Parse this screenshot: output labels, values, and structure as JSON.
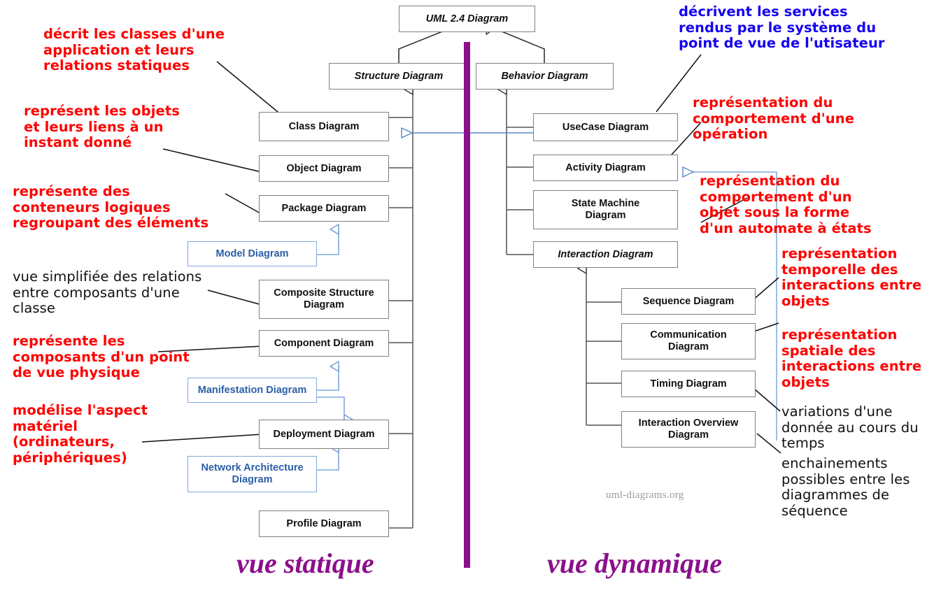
{
  "meta": {
    "watermark": "uml-diagrams.org",
    "divider_color": "#8B0F8B",
    "red": "#FF0000",
    "blue_text": "#1400F0",
    "blue_box": "#2B5EA8",
    "box_border": "#808080"
  },
  "view_labels": {
    "left": "vue statique",
    "right": "vue dynamique"
  },
  "root": {
    "label": "UML 2.4 Diagram"
  },
  "branches": {
    "structure": {
      "label": "Structure Diagram"
    },
    "behavior": {
      "label": "Behavior Diagram"
    }
  },
  "structure_children": [
    {
      "label": "Class Diagram"
    },
    {
      "label": "Object Diagram"
    },
    {
      "label": "Package Diagram"
    },
    {
      "label": "Composite Structure\nDiagram"
    },
    {
      "label": "Component Diagram"
    },
    {
      "label": "Deployment Diagram"
    },
    {
      "label": "Profile Diagram"
    }
  ],
  "structure_blue_children": [
    {
      "label": "Model Diagram"
    },
    {
      "label": "Manifestation Diagram"
    },
    {
      "label": "Network Architecture\nDiagram"
    }
  ],
  "behavior_children": [
    {
      "label": "UseCase Diagram"
    },
    {
      "label": "Activity Diagram"
    },
    {
      "label": "State Machine\nDiagram"
    },
    {
      "label": "Interaction Diagram"
    }
  ],
  "interaction_children": [
    {
      "label": "Sequence Diagram"
    },
    {
      "label": "Communication\nDiagram"
    },
    {
      "label": "Timing Diagram"
    },
    {
      "label": "Interaction Overview\nDiagram"
    }
  ],
  "annotations": [
    {
      "id": "class",
      "color": "red",
      "text": "décrit les classes d'une\napplication et leurs\nrelations statiques"
    },
    {
      "id": "object",
      "color": "red",
      "text": "représent les objets\net leurs liens à un\ninstant donné"
    },
    {
      "id": "package",
      "color": "red",
      "text": "représente des\nconteneurs logiques\nregroupant des éléments"
    },
    {
      "id": "composite",
      "color": "black",
      "text": "vue simplifiée des relations\nentre composants d'une\nclasse"
    },
    {
      "id": "component",
      "color": "red",
      "text": "représente les\ncomposants d'un point\nde vue physique"
    },
    {
      "id": "deployment",
      "color": "red",
      "text": "modélise l'aspect\nmatériel\n(ordinateurs,\npériphériques)"
    },
    {
      "id": "usecase",
      "color": "blue",
      "text": "décrivent les services\nrendus par le système du\npoint de vue de l'utisateur"
    },
    {
      "id": "activity",
      "color": "red",
      "text": "représentation du\ncomportement d'une\nopération"
    },
    {
      "id": "state",
      "color": "red",
      "text": "représentation du\ncomportement d'un\nobjet sous la forme\nd'un automate à états"
    },
    {
      "id": "sequence",
      "color": "red",
      "text": "représentation\ntemporelle des\ninteractions entre\nobjets"
    },
    {
      "id": "communication",
      "color": "red",
      "text": "représentation\nspatiale des\ninteractions entre\nobjets"
    },
    {
      "id": "timing",
      "color": "black",
      "text": "variations d'une\ndonnée au cours du\ntemps"
    },
    {
      "id": "overview",
      "color": "black",
      "text": "enchainements\npossibles entre les\ndiagrammes de\nséquence"
    }
  ]
}
